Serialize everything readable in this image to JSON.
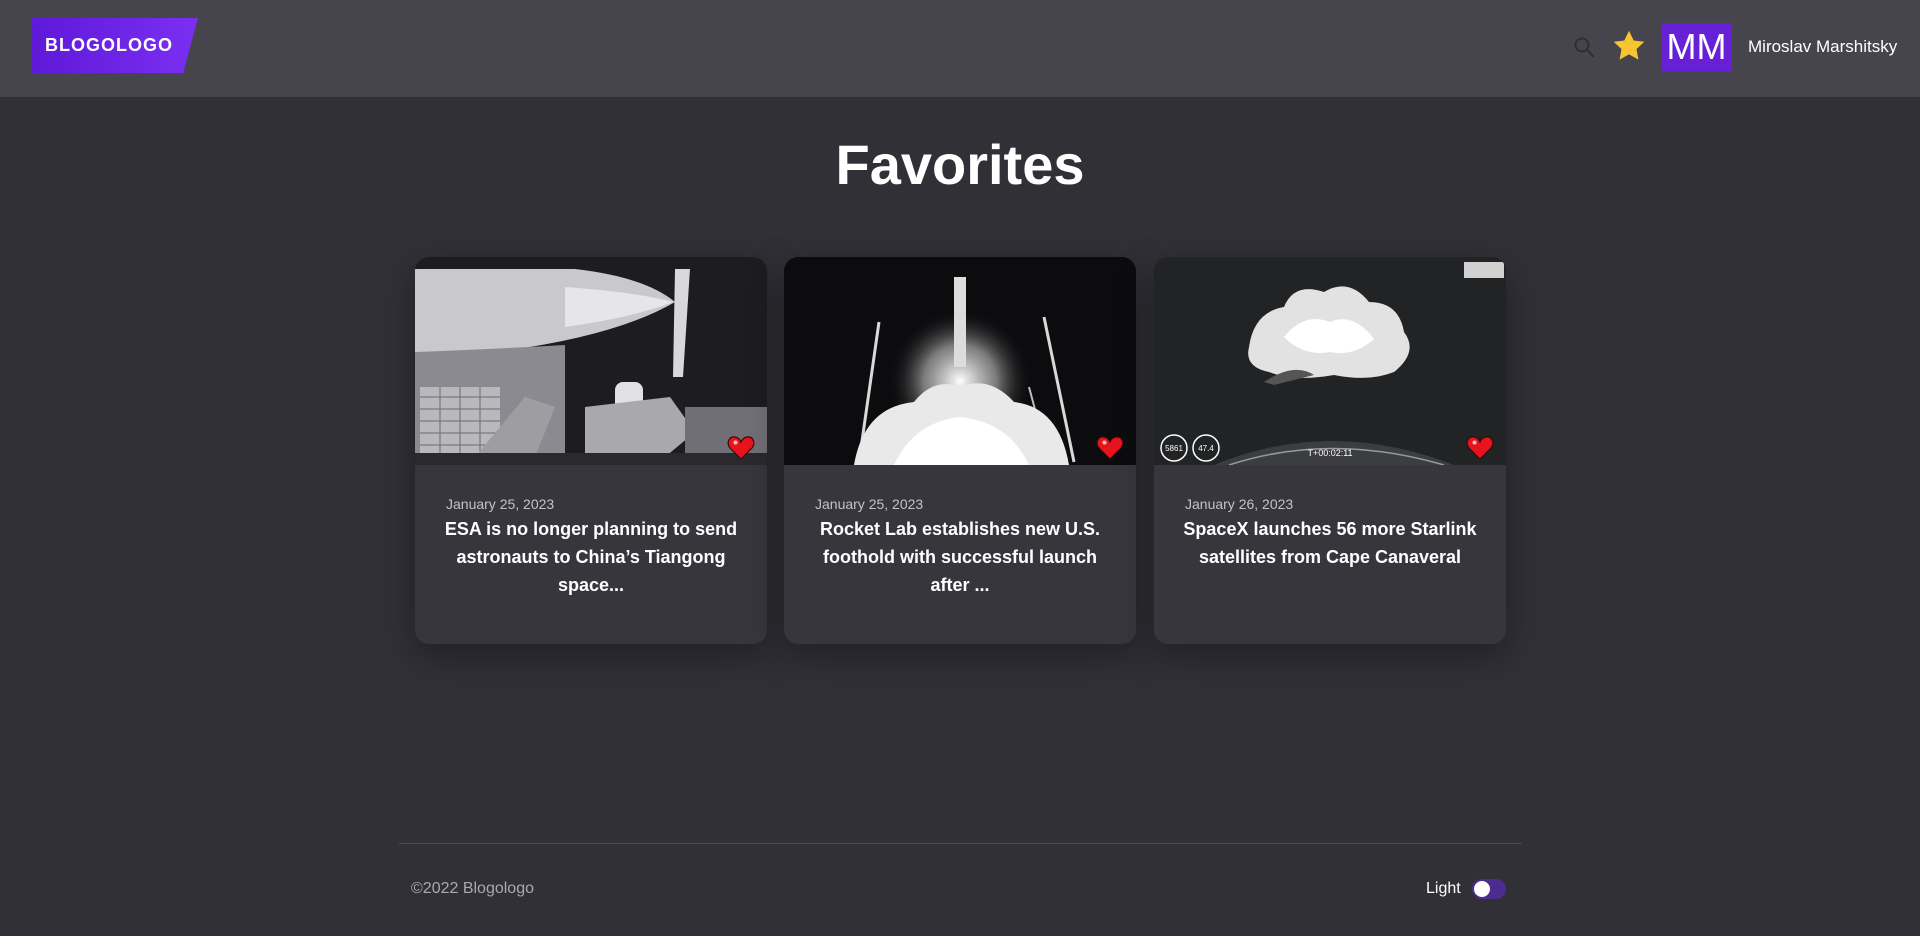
{
  "header": {
    "logo": "BLOGOLOGO",
    "user_initials": "MM",
    "user_name": "Miroslav Marshitsky",
    "icons": [
      "search-icon",
      "star-icon"
    ],
    "accent_color": "#6720d6",
    "favorite_star_color": "#f7c531"
  },
  "main": {
    "title": "Favorites",
    "cards": [
      {
        "date": "January 25, 2023",
        "title": "ESA is no longer planning to send astronauts to China’s Tiangong space...",
        "favorited": true
      },
      {
        "date": "January 25, 2023",
        "title": "Rocket Lab establishes new U.S. foothold with successful launch after ...",
        "favorited": true
      },
      {
        "date": "January 26, 2023",
        "title": "SpaceX launches 56 more Starlink satellites from Cape Canaveral",
        "favorited": true,
        "image_overlay": {
          "gauge_left": "5861",
          "gauge_right": "47.4",
          "timer": "T+00:02:11"
        }
      }
    ]
  },
  "footer": {
    "copyright": "©2022 Blogologo",
    "theme_label": "Light",
    "theme_toggle_on": true
  }
}
